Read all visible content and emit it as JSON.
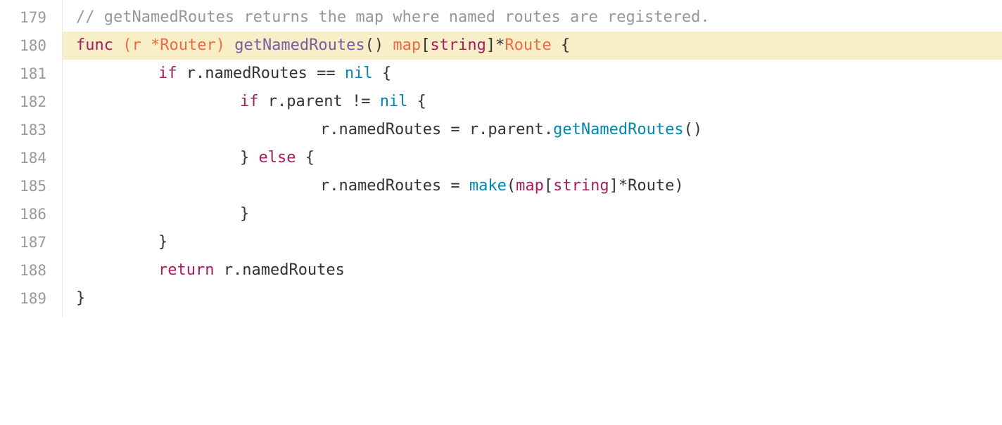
{
  "lines": [
    {
      "number": "179",
      "tokens": [
        "// getNamedRoutes returns the map where named routes are registered."
      ]
    },
    {
      "number": "180",
      "tokens": [
        "func",
        " ",
        "(r ",
        "*Router",
        ")",
        " ",
        "getNamedRoutes",
        "() ",
        "map",
        "[",
        "string",
        "]*",
        "Route",
        " {"
      ]
    },
    {
      "number": "181",
      "tokens": [
        "if",
        " r.namedRoutes == ",
        "nil",
        " {"
      ]
    },
    {
      "number": "182",
      "tokens": [
        "if",
        " r.parent != ",
        "nil",
        " {"
      ]
    },
    {
      "number": "183",
      "tokens": [
        "r.namedRoutes = r.parent.",
        "getNamedRoutes",
        "()"
      ]
    },
    {
      "number": "184",
      "tokens": [
        "} ",
        "else",
        " {"
      ]
    },
    {
      "number": "185",
      "tokens": [
        "r.namedRoutes = ",
        "make",
        "(",
        "map",
        "[",
        "string",
        "]*Route)"
      ]
    },
    {
      "number": "186",
      "tokens": [
        "}"
      ]
    },
    {
      "number": "187",
      "tokens": [
        "}"
      ]
    },
    {
      "number": "188",
      "tokens": [
        "return",
        " r.namedRoutes"
      ]
    },
    {
      "number": "189",
      "tokens": [
        "}"
      ]
    }
  ],
  "colors": {
    "comment": "#969896",
    "keyword": "#a71d5d",
    "type_orange": "#ed6a43",
    "function_purple": "#795da3",
    "call_blue": "#0086b3",
    "highlight": "#f8eec7",
    "line_number": "#999999"
  }
}
